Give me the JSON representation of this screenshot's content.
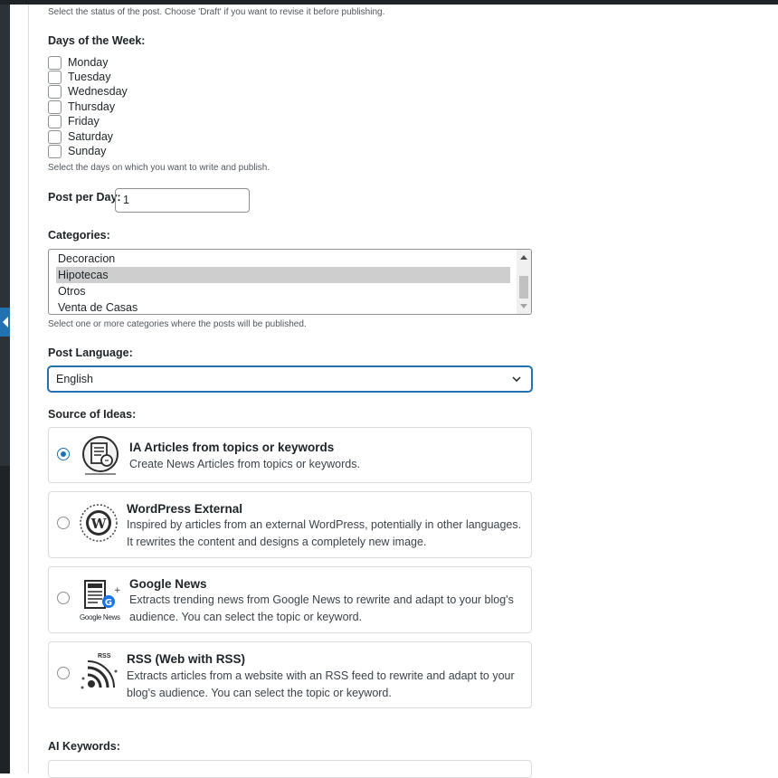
{
  "status_help": "Select the status of the post. Choose 'Draft' if you want to revise it before publishing.",
  "days": {
    "label": "Days of the Week:",
    "items": [
      "Monday",
      "Tuesday",
      "Wednesday",
      "Thursday",
      "Friday",
      "Saturday",
      "Sunday"
    ],
    "help": "Select the days on which you want to write and publish."
  },
  "post_per_day": {
    "label": "Post per Day:",
    "value": "1"
  },
  "categories": {
    "label": "Categories:",
    "options": [
      "Decoracion",
      "Hipotecas",
      "Otros",
      "Venta de Casas"
    ],
    "selected": "Hipotecas",
    "help": "Select one or more categories where the posts will be published."
  },
  "language": {
    "label": "Post Language:",
    "value": "English"
  },
  "sources": {
    "label": "Source of Ideas:",
    "items": [
      {
        "title": "IA Articles from topics or keywords",
        "desc": "Create News Articles from topics or keywords.",
        "checked": true,
        "icon": "document-icon"
      },
      {
        "title": "WordPress External",
        "desc": "Inspired by articles from an external WordPress, potentially in other languages. It rewrites the content and designs a completely new image.",
        "checked": false,
        "icon": "wordpress-icon"
      },
      {
        "title": "Google News",
        "desc": "Extracts trending news from Google News to rewrite and adapt to your blog's audience. You can select the topic or keyword.",
        "checked": false,
        "icon": "google-news-icon",
        "icon_caption": "Google News"
      },
      {
        "title": "RSS (Web with RSS)",
        "desc": "Extracts articles from a website with an RSS feed to rewrite and adapt to your blog's audience. You can select the topic or keyword.",
        "checked": false,
        "icon": "rss-icon",
        "icon_caption": "RSS"
      }
    ]
  },
  "keywords": {
    "label": "AI Keywords:"
  },
  "colors": {
    "accent": "#2271b1",
    "border": "#8c8f94",
    "text": "#1d2327"
  }
}
